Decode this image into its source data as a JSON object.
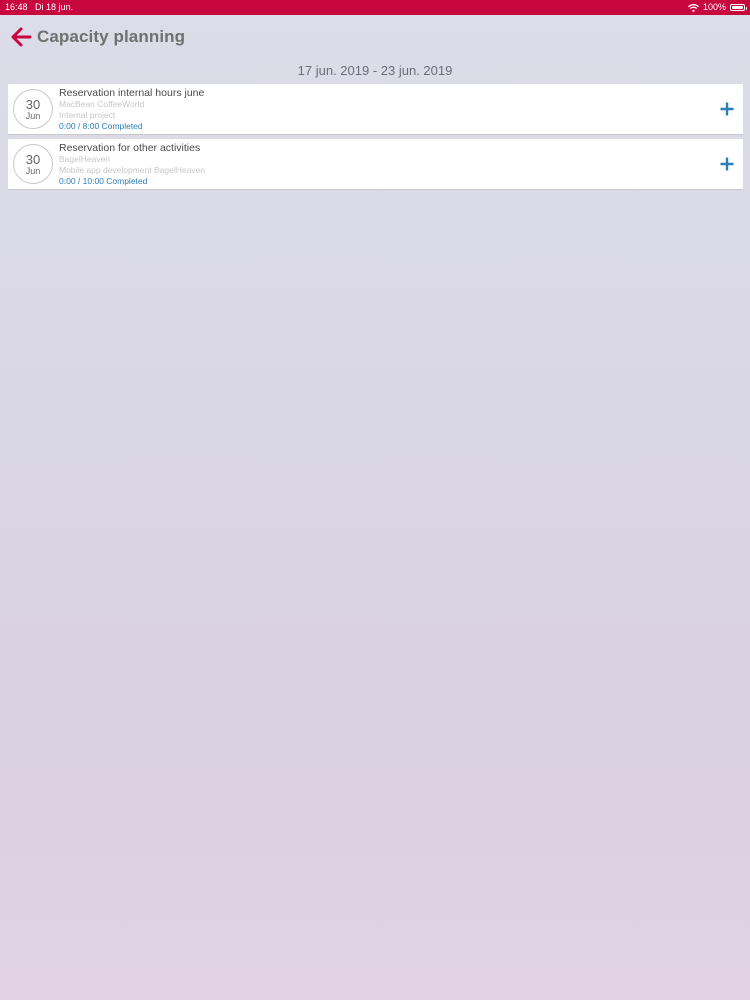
{
  "status_bar": {
    "time": "16:48",
    "date": "Di 18 jun.",
    "battery": "100%",
    "battery_level": 1.0
  },
  "header": {
    "back_icon": "arrow-left-icon",
    "title": "Capacity planning"
  },
  "date_range": "17 jun. 2019 - 23 jun. 2019",
  "colors": {
    "accent": "#c8073f",
    "link": "#2b7fb8",
    "add_icon": "#2b7fb8"
  },
  "reservations": [
    {
      "day": "30",
      "month": "Jun",
      "title": "Reservation internal hours june",
      "client": "MacBean CoffeeWorld",
      "project": "Internal project",
      "status": "0:00 / 8:00 Completed",
      "action_icon": "plus-icon"
    },
    {
      "day": "30",
      "month": "Jun",
      "title": "Reservation for other activities",
      "client": "BagelHeaven",
      "project": "Mobile app development BagelHeaven",
      "status": "0:00 / 10:00 Completed",
      "action_icon": "plus-icon"
    }
  ]
}
